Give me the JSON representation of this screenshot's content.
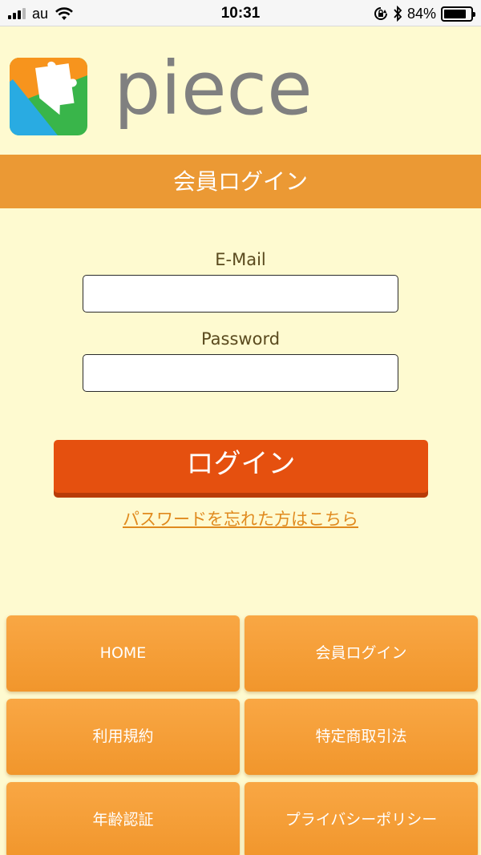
{
  "status_bar": {
    "carrier": "au",
    "time": "10:31",
    "battery_percent": "84%",
    "battery_level": 0.84,
    "icons": [
      "signal-icon",
      "wifi-icon",
      "rotation-lock-icon",
      "bluetooth-icon",
      "battery-icon"
    ]
  },
  "brand": {
    "name": "piece",
    "colors": {
      "orange": "#f7941d",
      "blue": "#29abe2",
      "green": "#39b54a",
      "text": "#808080"
    }
  },
  "header": {
    "title": "会員ログイン",
    "color": "#eb9934"
  },
  "login_form": {
    "email_label": "E-Mail",
    "email_value": "",
    "password_label": "Password",
    "password_value": "",
    "submit_label": "ログイン",
    "submit_color": "#e5500f",
    "forgot_link": "パスワードを忘れた方はこちら"
  },
  "footer_nav": [
    {
      "label": "HOME"
    },
    {
      "label": "会員ログイン"
    },
    {
      "label": "利用規約"
    },
    {
      "label": "特定商取引法"
    },
    {
      "label": "年齢認証"
    },
    {
      "label": "プライバシーポリシー"
    }
  ]
}
